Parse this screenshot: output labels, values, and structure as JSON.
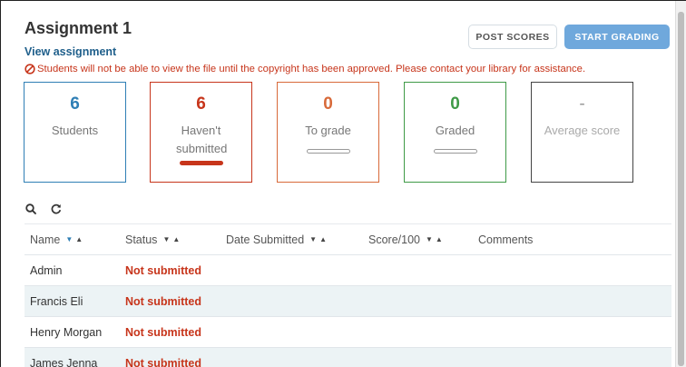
{
  "header": {
    "title": "Assignment 1",
    "view_link": "View assignment",
    "post_scores": "POST SCORES",
    "start_grading": "START GRADING"
  },
  "warning": "Students will not be able to view the file until the copyright has been approved. Please contact your library for assistance.",
  "cards": [
    {
      "value": "6",
      "label": "Students"
    },
    {
      "value": "6",
      "label": "Haven't submitted"
    },
    {
      "value": "0",
      "label": "To grade"
    },
    {
      "value": "0",
      "label": "Graded"
    },
    {
      "value": "-",
      "label": "Average score"
    }
  ],
  "table": {
    "columns": {
      "name": "Name",
      "status": "Status",
      "date": "Date Submitted",
      "score": "Score/100",
      "comments": "Comments"
    },
    "rows": [
      {
        "name": "Admin",
        "status": "Not submitted"
      },
      {
        "name": "Francis Eli",
        "status": "Not submitted"
      },
      {
        "name": "Henry Morgan",
        "status": "Not submitted"
      },
      {
        "name": "James Jenna",
        "status": "Not submitted"
      }
    ]
  },
  "colors": {
    "accent": "#2f7fb5",
    "error": "#c7351b",
    "to_grade": "#d86a3a",
    "graded": "#3f9a47"
  },
  "icons": [
    "ban-icon",
    "search-icon",
    "refresh-icon",
    "sort-desc-icon",
    "sort-asc-icon"
  ]
}
